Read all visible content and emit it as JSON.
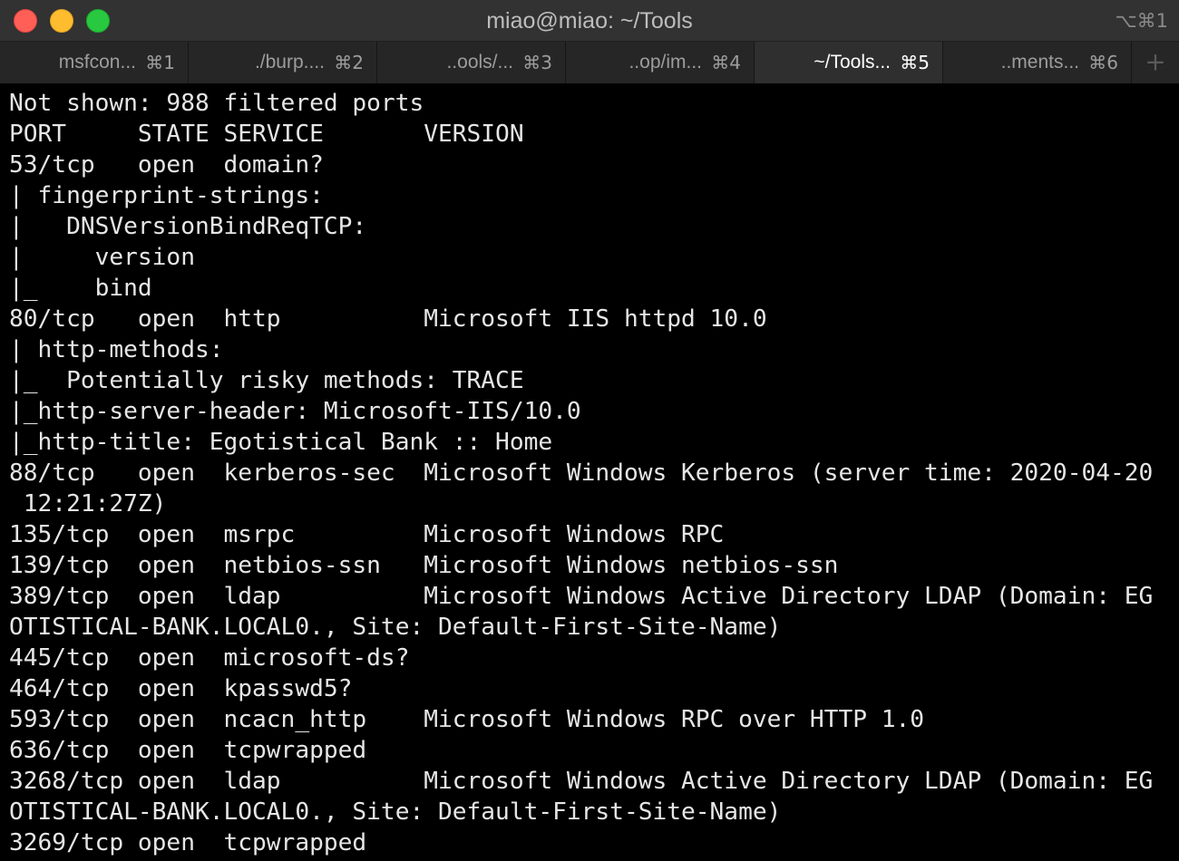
{
  "window": {
    "title": "miao@miao: ~/Tools",
    "shortcut": "⌥⌘1"
  },
  "tabs": [
    {
      "label": "msfcon...",
      "key": "⌘1"
    },
    {
      "label": "./burp....",
      "key": "⌘2"
    },
    {
      "label": "..ools/...",
      "key": "⌘3"
    },
    {
      "label": "..op/im...",
      "key": "⌘4"
    },
    {
      "label": "~/Tools...",
      "key": "⌘5",
      "active": true
    },
    {
      "label": "..ments...",
      "key": "⌘6"
    }
  ],
  "tab_add_label": "+",
  "terminal": {
    "lines": [
      "Not shown: 988 filtered ports",
      "PORT     STATE SERVICE       VERSION",
      "53/tcp   open  domain?",
      "| fingerprint-strings:",
      "|   DNSVersionBindReqTCP:",
      "|     version",
      "|_    bind",
      "80/tcp   open  http          Microsoft IIS httpd 10.0",
      "| http-methods:",
      "|_  Potentially risky methods: TRACE",
      "|_http-server-header: Microsoft-IIS/10.0",
      "|_http-title: Egotistical Bank :: Home",
      "88/tcp   open  kerberos-sec  Microsoft Windows Kerberos (server time: 2020-04-20",
      " 12:21:27Z)",
      "135/tcp  open  msrpc         Microsoft Windows RPC",
      "139/tcp  open  netbios-ssn   Microsoft Windows netbios-ssn",
      "389/tcp  open  ldap          Microsoft Windows Active Directory LDAP (Domain: EG",
      "OTISTICAL-BANK.LOCAL0., Site: Default-First-Site-Name)",
      "445/tcp  open  microsoft-ds?",
      "464/tcp  open  kpasswd5?",
      "593/tcp  open  ncacn_http    Microsoft Windows RPC over HTTP 1.0",
      "636/tcp  open  tcpwrapped",
      "3268/tcp open  ldap          Microsoft Windows Active Directory LDAP (Domain: EG",
      "OTISTICAL-BANK.LOCAL0., Site: Default-First-Site-Name)",
      "3269/tcp open  tcpwrapped"
    ]
  },
  "colors": {
    "background": "#000000",
    "text": "#e6e6e6",
    "titlebar": "#323232",
    "active_tab": "#2f2f2f",
    "close": "#ff5f57",
    "minimize": "#febc2e",
    "zoom": "#28c840"
  }
}
